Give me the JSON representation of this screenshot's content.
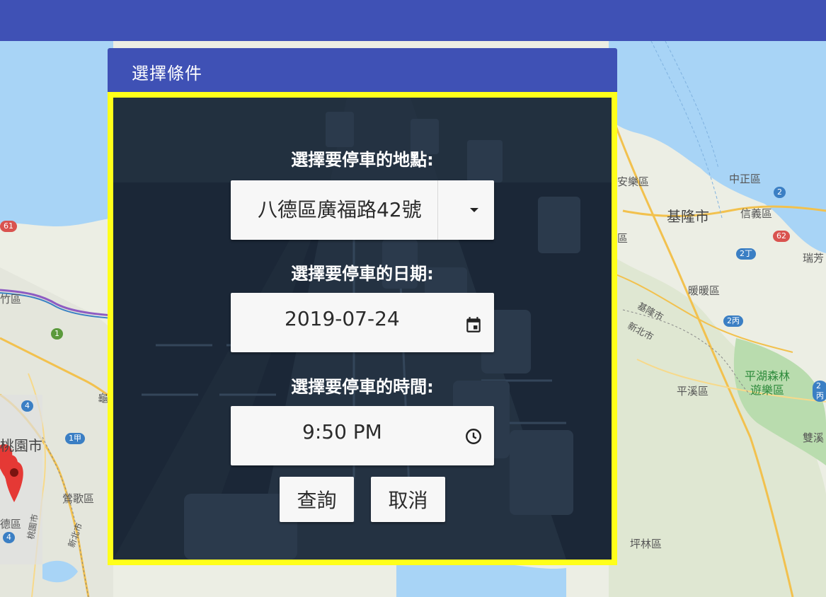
{
  "dialog": {
    "title": "選擇條件"
  },
  "location": {
    "label": "選擇要停車的地點:",
    "selected": "八德區廣福路42號",
    "icon": "dropdown-caret-icon"
  },
  "date": {
    "label": "選擇要停車的日期:",
    "value": "2019-07-24",
    "icon": "calendar-icon"
  },
  "time": {
    "label": "選擇要停車的時間:",
    "value": "9:50 PM",
    "icon": "clock-icon"
  },
  "buttons": {
    "search": "查詢",
    "cancel": "取消"
  },
  "map": {
    "labels": {
      "anle": "安樂區",
      "zhongzheng": "中正區",
      "keelung": "基隆市",
      "xinyi": "信義區",
      "ruifang": "瑞芳",
      "nuannuan": "暖暖區",
      "keelung_city_boundary": "基隆市",
      "new_taipei_boundary": "新北市",
      "pingxi": "平溪區",
      "pinghu": "平湖森林",
      "pinghu2": "遊樂區",
      "shuang": "雙溪",
      "pinglin": "坪林區",
      "zhuwei": "竹區",
      "taoyuan": "桃園市",
      "yingge": "鶯歌區",
      "bade": "德區",
      "gui": "龜",
      "taoyuan_city_boundary": "桃園市",
      "new_taipei_boundary2": "新北市",
      "qu_left": "區"
    },
    "shields": {
      "s61": "61",
      "s2": "2",
      "s62": "62",
      "s2ding": "2丁",
      "s2bing": "2丙",
      "s2bing_right": "2丙",
      "s1jia": "1甲",
      "s4a": "4",
      "s4b": "4",
      "s1": "1"
    }
  },
  "colors": {
    "app_bar": "#3f51b5",
    "dialog_border": "#ffff1a",
    "dialog_body_bg": "#1c2838",
    "control_bg": "#f7f7f7"
  }
}
